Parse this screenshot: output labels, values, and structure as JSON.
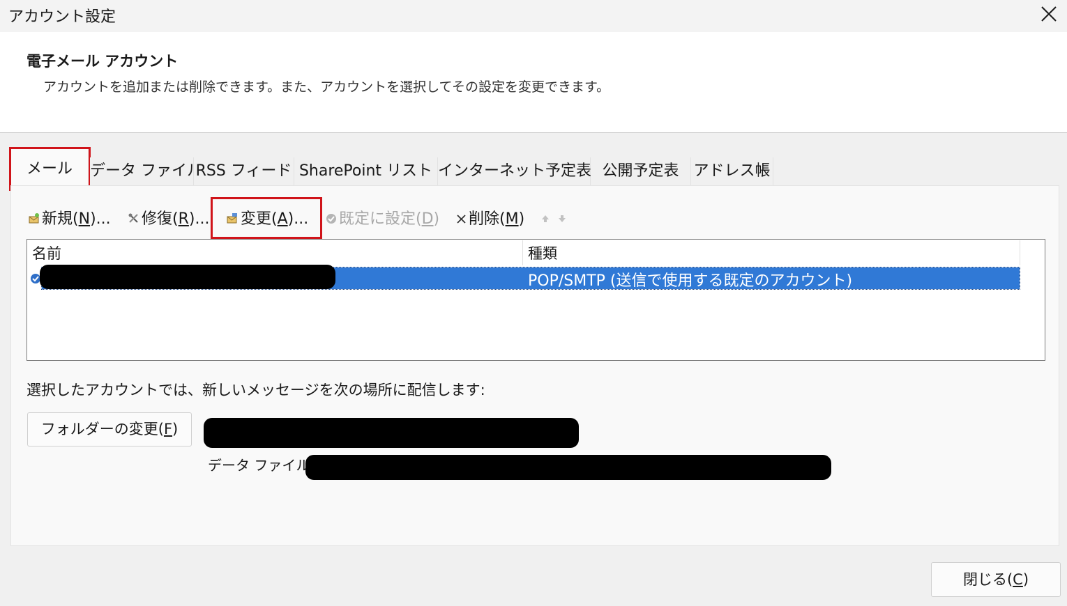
{
  "window": {
    "title": "アカウント設定"
  },
  "header": {
    "title": "電子メール アカウント",
    "description": "アカウントを追加または削除できます。また、アカウントを選択してその設定を変更できます。"
  },
  "tabs": [
    {
      "label": "メール",
      "active": true
    },
    {
      "label": "データ ファイル"
    },
    {
      "label": "RSS フィード"
    },
    {
      "label": "SharePoint リスト"
    },
    {
      "label": "インターネット予定表"
    },
    {
      "label": "公開予定表"
    },
    {
      "label": "アドレス帳"
    }
  ],
  "toolbar": {
    "new_label": "新規(N)...",
    "repair_label": "修復(R)...",
    "change_label": "変更(A)...",
    "set_default_label": "既定に設定(D)",
    "remove_label": "削除(M)"
  },
  "list": {
    "columns": [
      "名前",
      "種類"
    ],
    "rows": [
      {
        "name": "",
        "type": "POP/SMTP (送信で使用する既定のアカウント)",
        "selected": true,
        "default": true
      }
    ]
  },
  "delivery": {
    "label": "選択したアカウントでは、新しいメッセージを次の場所に配信します:",
    "change_folder_label": "フォルダーの変更(F)",
    "data_file_label": "データ ファイル:"
  },
  "footer": {
    "close_label": "閉じる(C)"
  },
  "colors": {
    "selection": "#3079d6",
    "highlight_box": "#d0141a"
  }
}
